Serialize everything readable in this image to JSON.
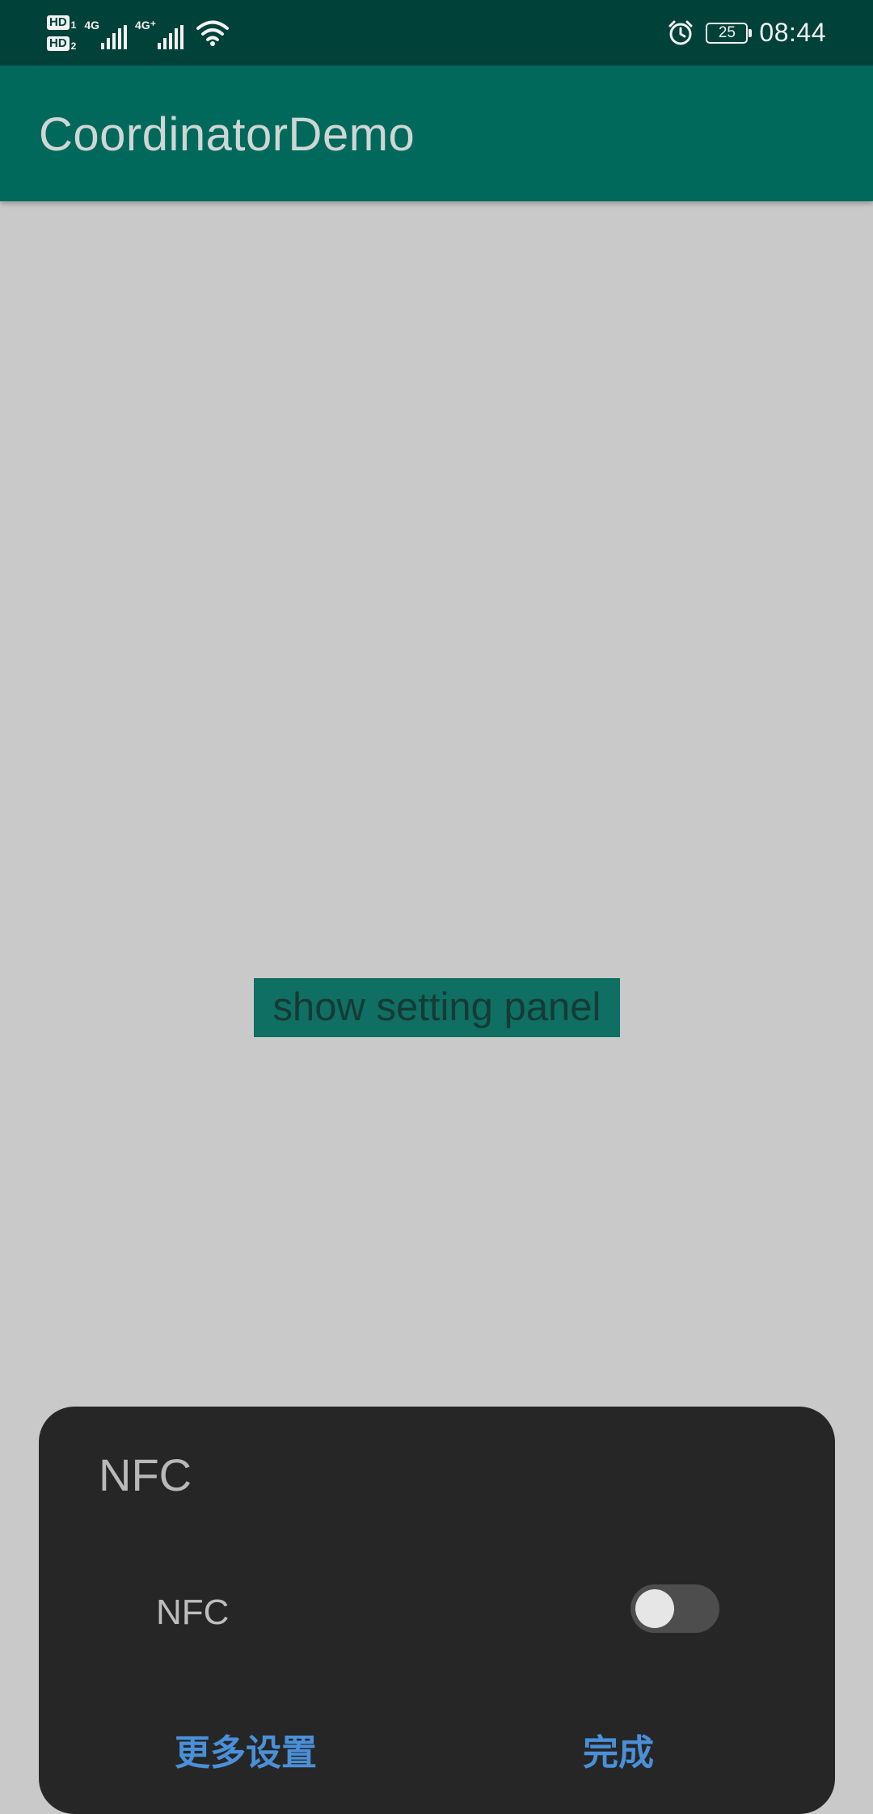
{
  "status_bar": {
    "sim1_badge": "HD",
    "sim1_index": "1",
    "sim2_badge": "HD",
    "sim2_index": "2",
    "network1": "4G",
    "network2": "4G⁺",
    "battery_level": "25",
    "time": "08:44"
  },
  "app_bar": {
    "title": "CoordinatorDemo"
  },
  "main": {
    "show_button_label": "show setting panel"
  },
  "panel": {
    "title": "NFC",
    "nfc_label": "NFC",
    "nfc_enabled": false,
    "more_settings_label": "更多设置",
    "done_label": "完成"
  },
  "colors": {
    "status_bar": "#00413a",
    "app_bar": "#00695c",
    "page_background": "#c9c9c9",
    "panel_background": "#262626",
    "panel_button_text": "#4a90d9"
  },
  "icons": [
    "signal-icon",
    "wifi-icon",
    "alarm-icon",
    "battery-icon"
  ]
}
